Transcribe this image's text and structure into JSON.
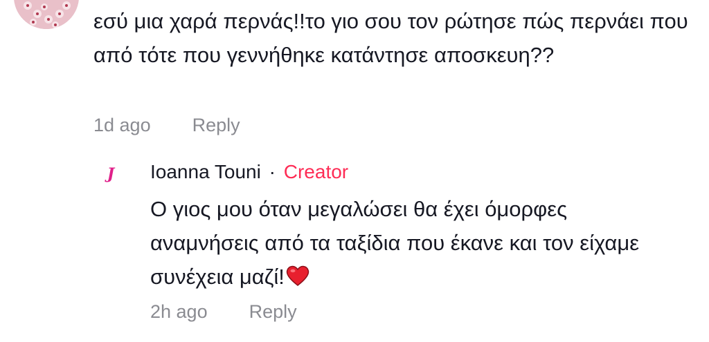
{
  "comment": {
    "text": "εσύ μια χαρά περνάς!!το γιο σου τον ρώτησε πώς περνάει που από τότε που γεννήθηκε κατάντησε αποσκευη??",
    "time": "1d ago",
    "reply_label": "Reply"
  },
  "reply": {
    "avatar_letter": "J",
    "author": "Ioanna Touni",
    "separator": "·",
    "badge": "Creator",
    "text": "Ο γιος μου όταν μεγαλώσει θα έχει όμορφες αναμνήσεις από τα ταξίδια που έκανε και τον είχαμε συνέχεια μαζί!",
    "emoji": "heart-emoji",
    "time": "2h ago",
    "reply_label": "Reply"
  },
  "colors": {
    "text": "#161823",
    "muted": "#8a8b91",
    "creator_badge": "#fe2c55",
    "avatar_letter": "#e0208a",
    "heart": "#e8202e"
  }
}
